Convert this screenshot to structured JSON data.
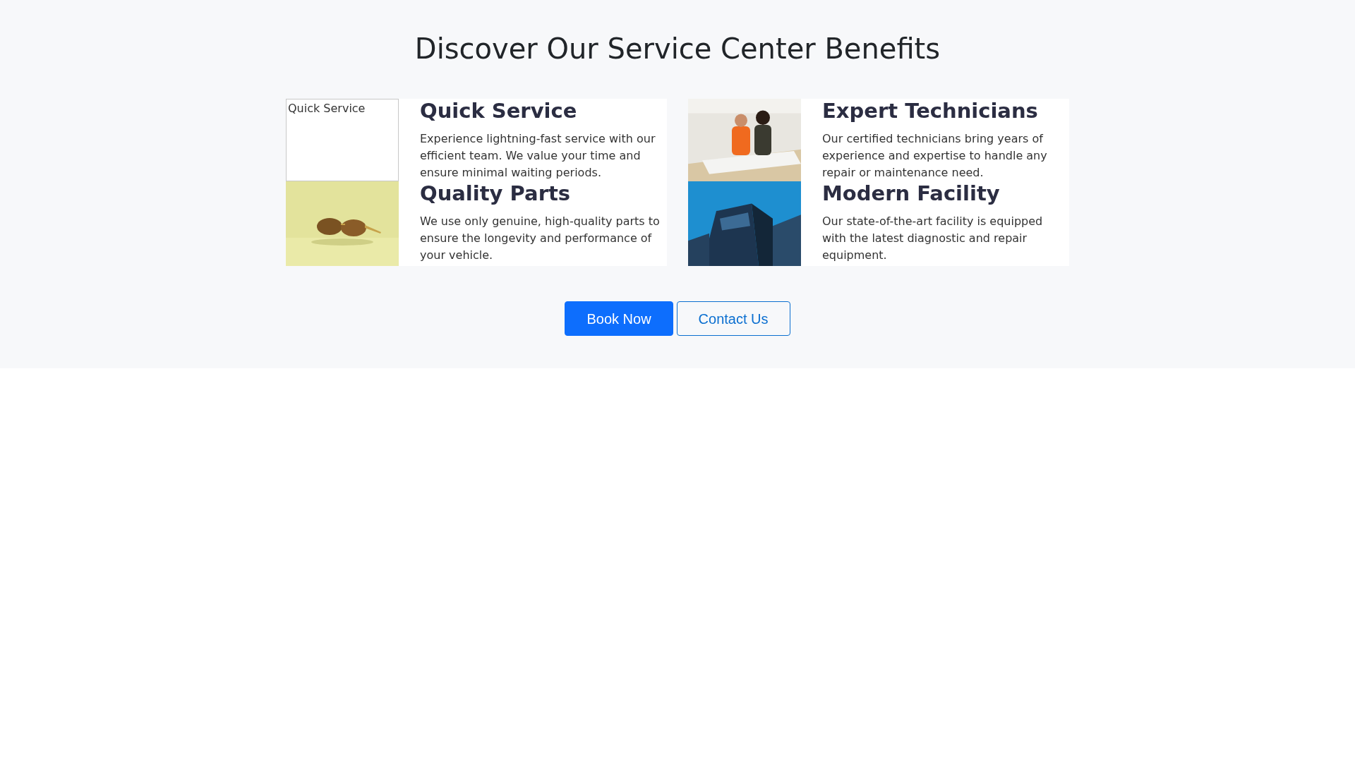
{
  "heading": "Discover Our Service Center Benefits",
  "benefits": [
    {
      "title": "Quick Service",
      "text": "Experience lightning-fast service with our efficient team. We value your time and ensure minimal waiting periods.",
      "image": {
        "kind": "broken",
        "alt": "Quick Service"
      }
    },
    {
      "title": "Expert Technicians",
      "text": "Our certified technicians bring years of experience and expertise to handle any repair or maintenance need."
    },
    {
      "title": "Quality Parts",
      "text": "We use only genuine, high-quality parts to ensure the longevity and performance of your vehicle."
    },
    {
      "title": "Modern Facility",
      "text": "Our state-of-the-art facility is equipped with the latest diagnostic and repair equipment."
    }
  ],
  "buttons": [
    {
      "label": "Book Now",
      "kind": "primary"
    },
    {
      "label": "Contact Us",
      "kind": "outline"
    }
  ]
}
